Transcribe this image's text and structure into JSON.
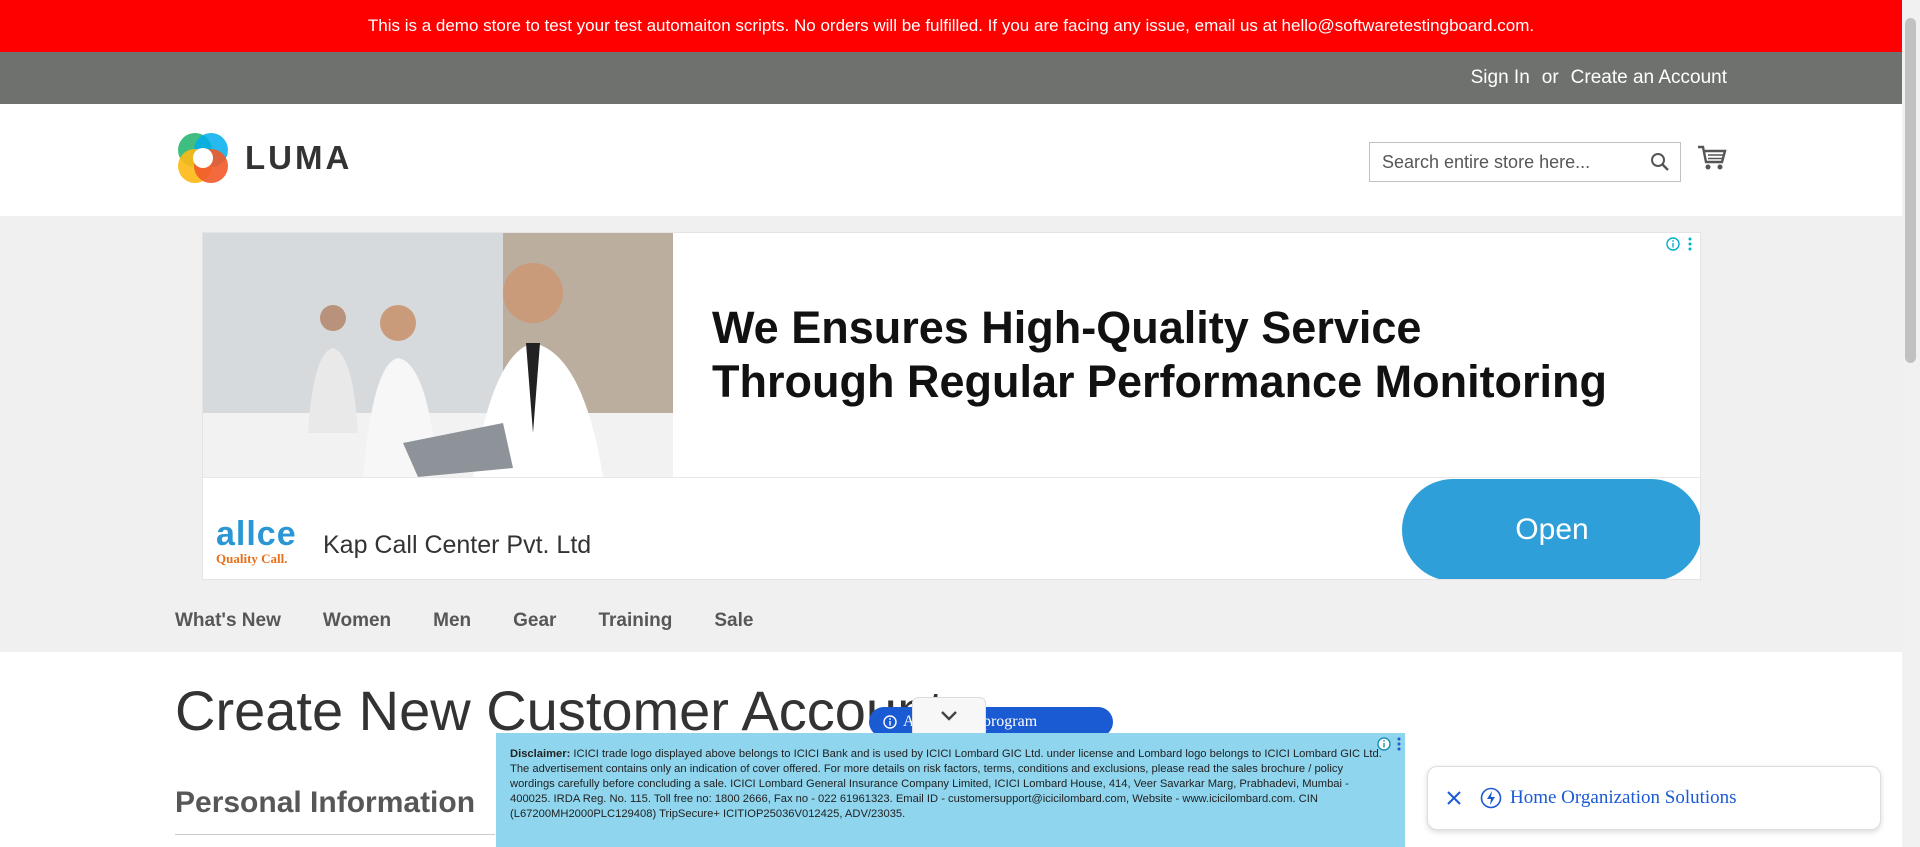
{
  "demo_banner": {
    "text": "This is a demo store to test your test automaiton scripts. No orders will be fulfilled. If you are facing any issue, email us at hello@softwaretestingboard.com."
  },
  "header": {
    "sign_in": "Sign In",
    "or": "or",
    "create_account": "Create an Account"
  },
  "logo": {
    "text": "LUMA"
  },
  "search": {
    "placeholder": "Search entire store here..."
  },
  "ad": {
    "headline": "We Ensures High-Quality Service Through Regular Performance Monitoring",
    "logo_text": "allce",
    "logo_tagline": "Quality Call.",
    "company": "Kap Call Center Pvt. Ltd",
    "button": "Open"
  },
  "nav": {
    "items": [
      "What's New",
      "Women",
      "Men",
      "Gear",
      "Training",
      "Sale"
    ]
  },
  "page": {
    "title": "Create New Customer Account",
    "section": "Personal Information"
  },
  "overlay": {
    "marketing_pill": "A...arketing program",
    "disclaimer_label": "Disclaimer:",
    "disclaimer_text": " ICICI trade logo displayed above belongs to ICICI Bank and is used by ICICI Lombard GIC Ltd. under license and Lombard logo belongs to ICICI Lombard GIC Ltd. The advertisement contains only an indication of cover offered. For more details on risk factors, terms, conditions and exclusions, please read the sales brochure / policy wordings carefully before concluding a sale. ICICI Lombard General Insurance Company Limited, ICICI Lombard House, 414, Veer Savarkar Marg, Prabhadevi, Mumbai - 400025. IRDA Reg. No. 115.  Toll free no: 1800 2666, Fax no - 022 61961323. Email ID - customersupport@icicilombard.com, Website - www.icicilombard.com. CIN (L67200MH2000PLC129408) TripSecure+ ICITIOP25036V012425, ADV/23035.",
    "side_ad_text": "Home Organization Solutions"
  },
  "colors": {
    "banner": "#ff0000",
    "header_bar": "#6e716e",
    "accent_blue": "#1a5ad3",
    "open_button": "#2e9fd8",
    "disclaimer_bg": "#8fd5ee"
  }
}
